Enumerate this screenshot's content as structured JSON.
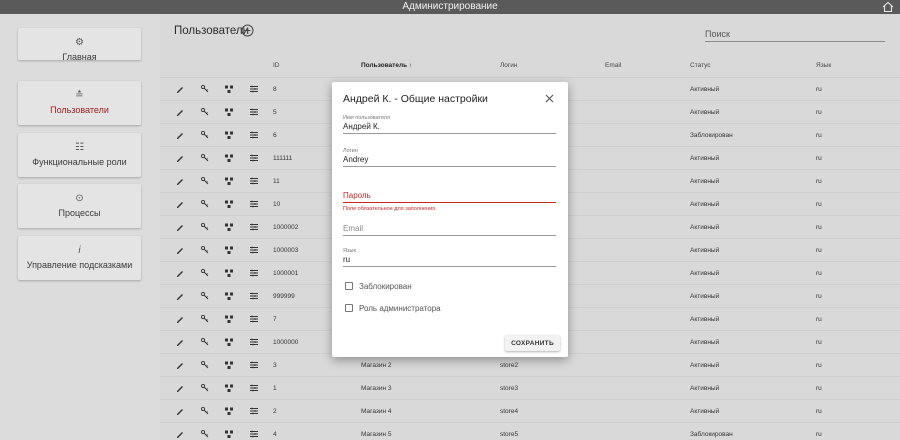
{
  "app": {
    "title": "Администрирование"
  },
  "sidebar": {
    "items": [
      {
        "label": "Главная",
        "icon": "gear-icon"
      },
      {
        "label": "Пользователи",
        "icon": "users-list-icon",
        "active": true
      },
      {
        "label": "Функциональные роли",
        "icon": "sliders-icon"
      },
      {
        "label": "Процессы",
        "icon": "play-circle-icon"
      },
      {
        "label": "Управление подсказками",
        "icon": "info-icon"
      }
    ]
  },
  "main": {
    "title": "Пользователи",
    "search": {
      "placeholder": "Поиск"
    },
    "table": {
      "columns": [
        "ID",
        "Пользователь ↑",
        "Логин",
        "Email",
        "Статус",
        "Язык"
      ],
      "rows": [
        {
          "id": "8",
          "user": "",
          "login": "",
          "email": "",
          "status": "Активный",
          "lang": "ru"
        },
        {
          "id": "5",
          "user": "",
          "login": "",
          "email": "",
          "status": "Активный",
          "lang": "ru"
        },
        {
          "id": "6",
          "user": "",
          "login": "",
          "email": "",
          "status": "Заблокирован",
          "lang": "ru"
        },
        {
          "id": "111111",
          "user": "",
          "login": "",
          "email": "",
          "status": "Активный",
          "lang": "ru"
        },
        {
          "id": "11",
          "user": "",
          "login": "",
          "email": "",
          "status": "Активный",
          "lang": "ru"
        },
        {
          "id": "10",
          "user": "",
          "login": "",
          "email": "",
          "status": "Активный",
          "lang": "ru"
        },
        {
          "id": "1000002",
          "user": "",
          "login": "",
          "email": "",
          "status": "Активный",
          "lang": "ru"
        },
        {
          "id": "1000003",
          "user": "",
          "login": "",
          "email": "",
          "status": "Активный",
          "lang": "ru"
        },
        {
          "id": "1000001",
          "user": "",
          "login": "",
          "email": "",
          "status": "Активный",
          "lang": "ru"
        },
        {
          "id": "999999",
          "user": "",
          "login": "",
          "email": "",
          "status": "Активный",
          "lang": "ru"
        },
        {
          "id": "7",
          "user": "",
          "login": "",
          "email": "",
          "status": "Активный",
          "lang": "ru"
        },
        {
          "id": "1000000",
          "user": "",
          "login": "",
          "email": "",
          "status": "Активный",
          "lang": "ru"
        },
        {
          "id": "3",
          "user": "Магазин 2",
          "login": "store2",
          "email": "",
          "status": "Активный",
          "lang": "ru"
        },
        {
          "id": "1",
          "user": "Магазин 3",
          "login": "store3",
          "email": "",
          "status": "Активный",
          "lang": "ru"
        },
        {
          "id": "2",
          "user": "Магазин 4",
          "login": "store4",
          "email": "",
          "status": "Активный",
          "lang": "ru"
        },
        {
          "id": "4",
          "user": "Магазин 5",
          "login": "store5",
          "email": "",
          "status": "Заблокирован",
          "lang": "ru"
        }
      ]
    }
  },
  "modal": {
    "title": "Андрей К. - Общие настройки",
    "fields": {
      "username": {
        "label": "Имя пользователя",
        "value": "Андрей К."
      },
      "login": {
        "label": "Логин",
        "value": "Andrey"
      },
      "password": {
        "placeholder": "Пароль",
        "error": "Поле обязательное для заполнения."
      },
      "email": {
        "placeholder": "Email"
      },
      "lang": {
        "label": "Язык",
        "value": "ru"
      }
    },
    "checkboxes": {
      "blocked": "Заблокирован",
      "admin": "Роль администратора"
    },
    "save_label": "СОХРАНИТЬ"
  },
  "colors": {
    "accent": "#9b1c1c",
    "error": "#c62828",
    "topbar": "#5a5a5a"
  }
}
